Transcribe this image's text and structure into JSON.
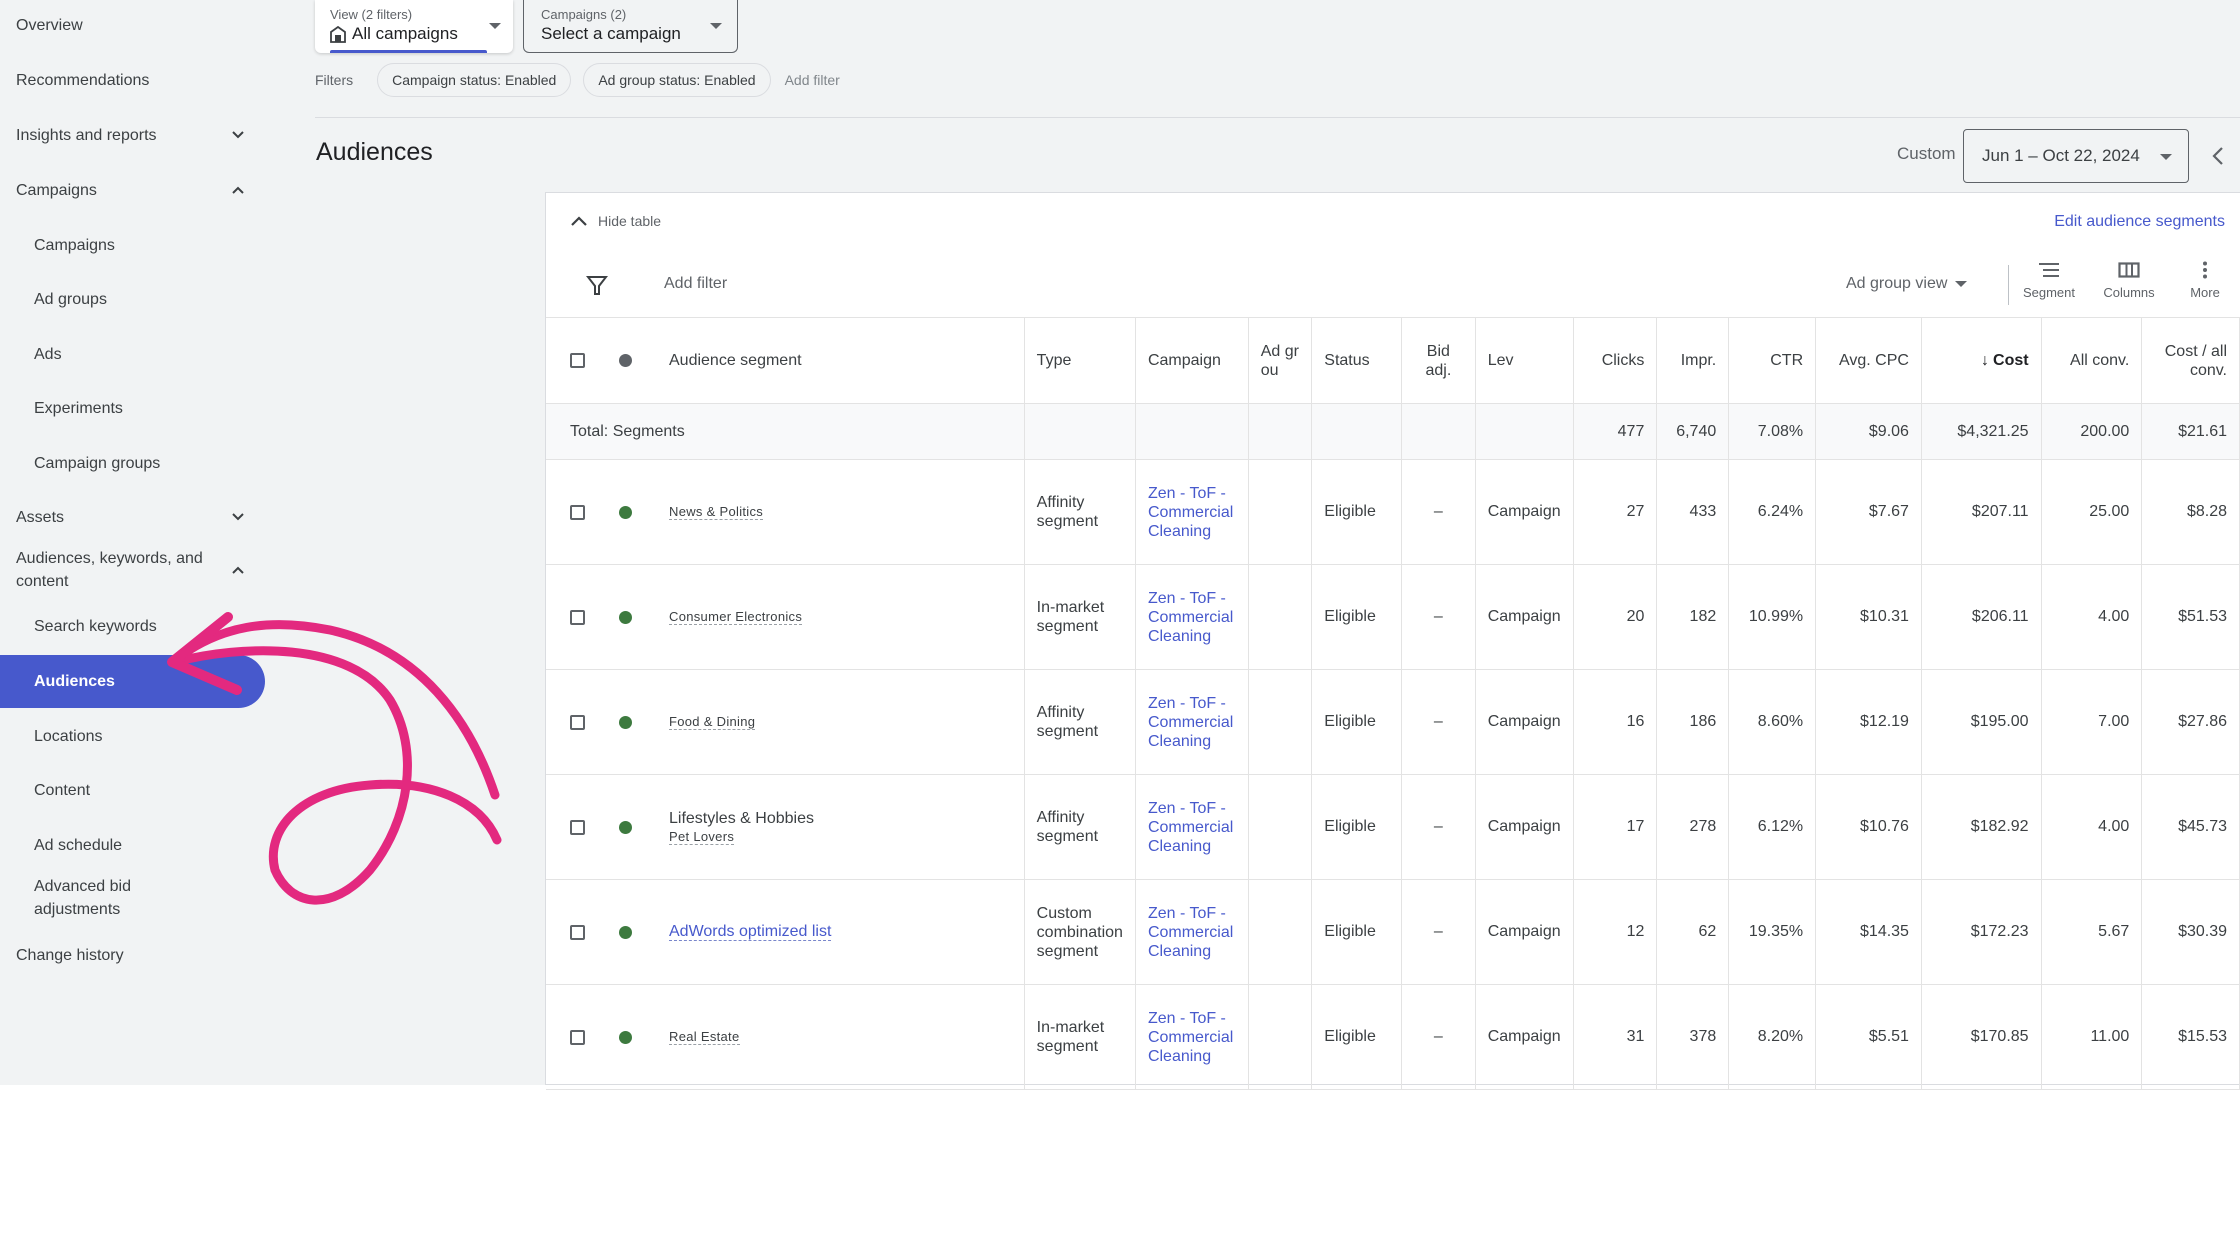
{
  "sidebar": {
    "items": [
      {
        "label": "Overview",
        "level": "top"
      },
      {
        "label": "Recommendations",
        "level": "top"
      },
      {
        "label": "Insights and reports",
        "level": "top",
        "chevron": "down"
      },
      {
        "label": "Campaigns",
        "level": "top",
        "chevron": "up"
      },
      {
        "label": "Campaigns",
        "level": "sub"
      },
      {
        "label": "Ad groups",
        "level": "sub"
      },
      {
        "label": "Ads",
        "level": "sub"
      },
      {
        "label": "Experiments",
        "level": "sub"
      },
      {
        "label": "Campaign groups",
        "level": "sub"
      },
      {
        "label": "Assets",
        "level": "top",
        "chevron": "down"
      },
      {
        "label": "Audiences, keywords, and content",
        "level": "top",
        "chevron": "up"
      },
      {
        "label": "Search keywords",
        "level": "sub"
      },
      {
        "label": "Audiences",
        "level": "sub",
        "active": true
      },
      {
        "label": "Locations",
        "level": "sub"
      },
      {
        "label": "Content",
        "level": "sub"
      },
      {
        "label": "Ad schedule",
        "level": "sub"
      },
      {
        "label": "Advanced bid adjustments",
        "level": "sub"
      },
      {
        "label": "Change history",
        "level": "top"
      }
    ]
  },
  "top_bar": {
    "view_small": "View (2 filters)",
    "view_value": "All campaigns",
    "campaigns_small": "Campaigns (2)",
    "campaigns_value": "Select a campaign"
  },
  "filters": {
    "label": "Filters",
    "chips": [
      "Campaign status: Enabled",
      "Ad group status: Enabled"
    ],
    "add_filter": "Add filter"
  },
  "page": {
    "title": "Audiences",
    "date_label": "Custom",
    "date_range": "Jun 1 – Oct 22, 2024"
  },
  "table_toolbar": {
    "hide_table": "Hide table",
    "edit_segments": "Edit audience segments",
    "add_filter": "Add filter",
    "view_selector": "Ad group view",
    "segment": "Segment",
    "columns": "Columns",
    "more": "More"
  },
  "colors": {
    "accent": "#4759cc",
    "status_enabled": "#3d7a3f",
    "status_header": "#5f6368",
    "annotation": "#e3297f"
  },
  "table": {
    "columns": {
      "segment": "Audience segment",
      "type": "Type",
      "campaign": "Campaign",
      "ad_group": "Ad grou",
      "status": "Status",
      "bid_adj": "Bid adj.",
      "level": "Lev",
      "clicks": "Clicks",
      "impr": "Impr.",
      "ctr": "CTR",
      "avg_cpc": "Avg. CPC",
      "cost": "Cost",
      "all_conv": "All conv.",
      "cost_per_conv": "Cost / all conv."
    },
    "sort_indicator": "↓",
    "total": {
      "label": "Total: Segments",
      "clicks": "477",
      "impr": "6,740",
      "ctr": "7.08%",
      "avg_cpc": "$9.06",
      "cost": "$4,321.25",
      "all_conv": "200.00",
      "cost_per_conv": "$21.61"
    },
    "rows": [
      {
        "parent": "",
        "segment": "News & Politics",
        "is_link": false,
        "type": "Affinity segment",
        "campaign": "Zen - ToF - Commercial Cleaning",
        "ad_group": "",
        "status": "Eligible",
        "bid_adj": "–",
        "level": "Campaign",
        "clicks": "27",
        "impr": "433",
        "ctr": "6.24%",
        "avg_cpc": "$7.67",
        "cost": "$207.11",
        "all_conv": "25.00",
        "cost_per_conv": "$8.28"
      },
      {
        "parent": "",
        "segment": "Consumer Electronics",
        "is_link": false,
        "type": "In-market segment",
        "campaign": "Zen - ToF - Commercial Cleaning",
        "ad_group": "",
        "status": "Eligible",
        "bid_adj": "–",
        "level": "Campaign",
        "clicks": "20",
        "impr": "182",
        "ctr": "10.99%",
        "avg_cpc": "$10.31",
        "cost": "$206.11",
        "all_conv": "4.00",
        "cost_per_conv": "$51.53"
      },
      {
        "parent": "",
        "segment": "Food & Dining",
        "is_link": false,
        "type": "Affinity segment",
        "campaign": "Zen - ToF - Commercial Cleaning",
        "ad_group": "",
        "status": "Eligible",
        "bid_adj": "–",
        "level": "Campaign",
        "clicks": "16",
        "impr": "186",
        "ctr": "8.60%",
        "avg_cpc": "$12.19",
        "cost": "$195.00",
        "all_conv": "7.00",
        "cost_per_conv": "$27.86"
      },
      {
        "parent": "Lifestyles & Hobbies",
        "segment": "Pet Lovers",
        "is_link": false,
        "type": "Affinity segment",
        "campaign": "Zen - ToF - Commercial Cleaning",
        "ad_group": "",
        "status": "Eligible",
        "bid_adj": "–",
        "level": "Campaign",
        "clicks": "17",
        "impr": "278",
        "ctr": "6.12%",
        "avg_cpc": "$10.76",
        "cost": "$182.92",
        "all_conv": "4.00",
        "cost_per_conv": "$45.73"
      },
      {
        "parent": "",
        "segment": "AdWords optimized list",
        "is_link": true,
        "type": "Custom combination segment",
        "campaign": "Zen - ToF - Commercial Cleaning",
        "ad_group": "",
        "status": "Eligible",
        "bid_adj": "–",
        "level": "Campaign",
        "clicks": "12",
        "impr": "62",
        "ctr": "19.35%",
        "avg_cpc": "$14.35",
        "cost": "$172.23",
        "all_conv": "5.67",
        "cost_per_conv": "$30.39"
      },
      {
        "parent": "",
        "segment": "Real Estate",
        "is_link": false,
        "type": "In-market segment",
        "campaign": "Zen - ToF - Commercial Cleaning",
        "ad_group": "",
        "status": "Eligible",
        "bid_adj": "–",
        "level": "Campaign",
        "clicks": "31",
        "impr": "378",
        "ctr": "8.20%",
        "avg_cpc": "$5.51",
        "cost": "$170.85",
        "all_conv": "11.00",
        "cost_per_conv": "$15.53"
      }
    ]
  }
}
